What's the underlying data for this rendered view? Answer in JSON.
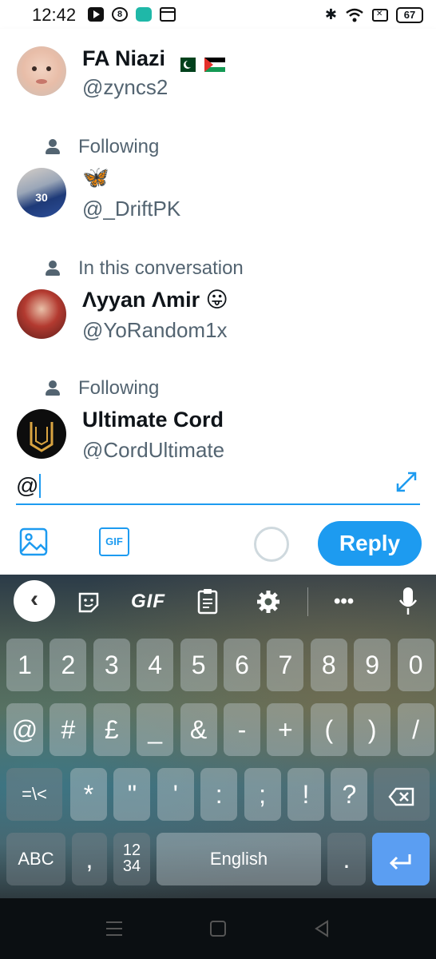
{
  "status_bar": {
    "time": "12:42",
    "battery": "67"
  },
  "suggestions": [
    {
      "context": "",
      "name": "FA Niazi",
      "handle": "@zyncs2",
      "flags": [
        "pakistan-flag",
        "palestine-flag"
      ]
    },
    {
      "context": "Following",
      "name": "🦋",
      "handle": "@_DriftPK"
    },
    {
      "context": "In this conversation",
      "name": "Λyyan Λmir 😛",
      "handle": "@YoRandom1x"
    },
    {
      "context": "Following",
      "name": "Ultimate Cord",
      "handle": "@CordUltimate"
    }
  ],
  "composer": {
    "input_value": "@",
    "reply_label": "Reply",
    "gif_label": "GIF"
  },
  "keyboard": {
    "toolbar": {
      "gif_label": "GIF",
      "more": "•••"
    },
    "row1": [
      "1",
      "2",
      "3",
      "4",
      "5",
      "6",
      "7",
      "8",
      "9",
      "0"
    ],
    "row2": [
      "@",
      "#",
      "£",
      "_",
      "&",
      "-",
      "+",
      "(",
      ")",
      "/"
    ],
    "row3": [
      "=\\<",
      "*",
      "\"",
      "'",
      ":",
      ";",
      "!",
      "?"
    ],
    "row4": {
      "abc": "ABC",
      "comma": ",",
      "numpad_top": "12",
      "numpad_bottom": "34",
      "space": "English",
      "period": "."
    }
  },
  "colors": {
    "accent": "#1d9bf0",
    "enter_key": "#5b9ef2"
  }
}
